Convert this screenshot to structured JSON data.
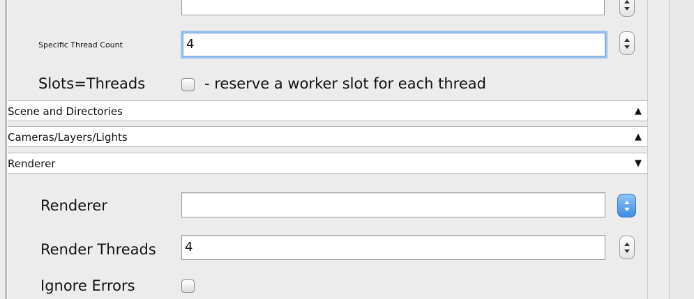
{
  "options": {
    "specific_thread_count_label": "Specific Thread Count",
    "specific_thread_count_value": "4",
    "slots_threads_label": "Slots=Threads",
    "slots_threads_desc": "- reserve a worker slot for each thread"
  },
  "sections": [
    {
      "title": "Scene and Directories",
      "state_icon": "▲"
    },
    {
      "title": "Cameras/Layers/Lights",
      "state_icon": "▲"
    },
    {
      "title": "Renderer",
      "state_icon": "▼"
    }
  ],
  "renderer": {
    "renderer_label": "Renderer",
    "renderer_value": "",
    "render_threads_label": "Render Threads",
    "render_threads_value": "4",
    "ignore_errors_label": "Ignore Errors"
  }
}
